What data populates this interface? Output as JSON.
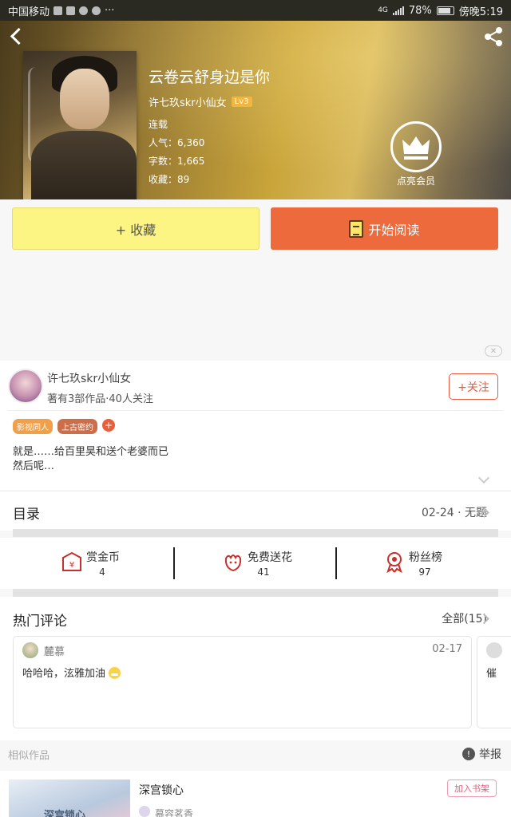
{
  "status_bar": {
    "carrier": "中国移动",
    "network": "4G",
    "battery": "78%",
    "time": "傍晚5:19"
  },
  "book": {
    "title": "云卷云舒身边是你",
    "author": "许七玖skr小仙女",
    "level": "Lv3",
    "status": "连载",
    "popularity_label": "人气：",
    "popularity": "6,360",
    "wordcount_label": "字数：",
    "wordcount": "1,665",
    "favorites_label": "收藏：",
    "favorites": "89",
    "vip_label": "点亮会员"
  },
  "actions": {
    "collect": "+ 收藏",
    "read": "开始阅读"
  },
  "author_card": {
    "name": "许七玖skr小仙女",
    "stats": "著有3部作品·40人关注",
    "follow": "+关注",
    "tags": [
      "影视同人",
      "上古密约"
    ],
    "tag_add": "+",
    "description_line1": "就是……给百里昊和送个老婆而已",
    "description_line2": "然后呢…"
  },
  "toc": {
    "label": "目录",
    "latest": "02-24 · 无题"
  },
  "stats": [
    {
      "label": "赏金币",
      "value": "4",
      "icon": "coin-envelope-icon"
    },
    {
      "label": "免费送花",
      "value": "41",
      "icon": "flower-icon"
    },
    {
      "label": "粉丝榜",
      "value": "97",
      "icon": "badge-icon"
    }
  ],
  "comments": {
    "label": "热门评论",
    "all": "全部(15)",
    "items": [
      {
        "user": "麓慕",
        "date": "02-17",
        "text": "哈哈哈，泫雅加油"
      },
      {
        "user": "",
        "date": "",
        "text": "催"
      }
    ]
  },
  "similar": {
    "label": "相似作品",
    "report": "举报",
    "report_mark": "!",
    "items": [
      {
        "title": "深宫锁心",
        "cover_text": "深宫锁心",
        "author": "慕容茗香",
        "add_label": "加入书架"
      }
    ]
  },
  "colors": {
    "accent": "#ec6a3c",
    "collect_bg": "#fcf583",
    "tag1": "#f0a048",
    "tag2": "#cc6e4a"
  }
}
